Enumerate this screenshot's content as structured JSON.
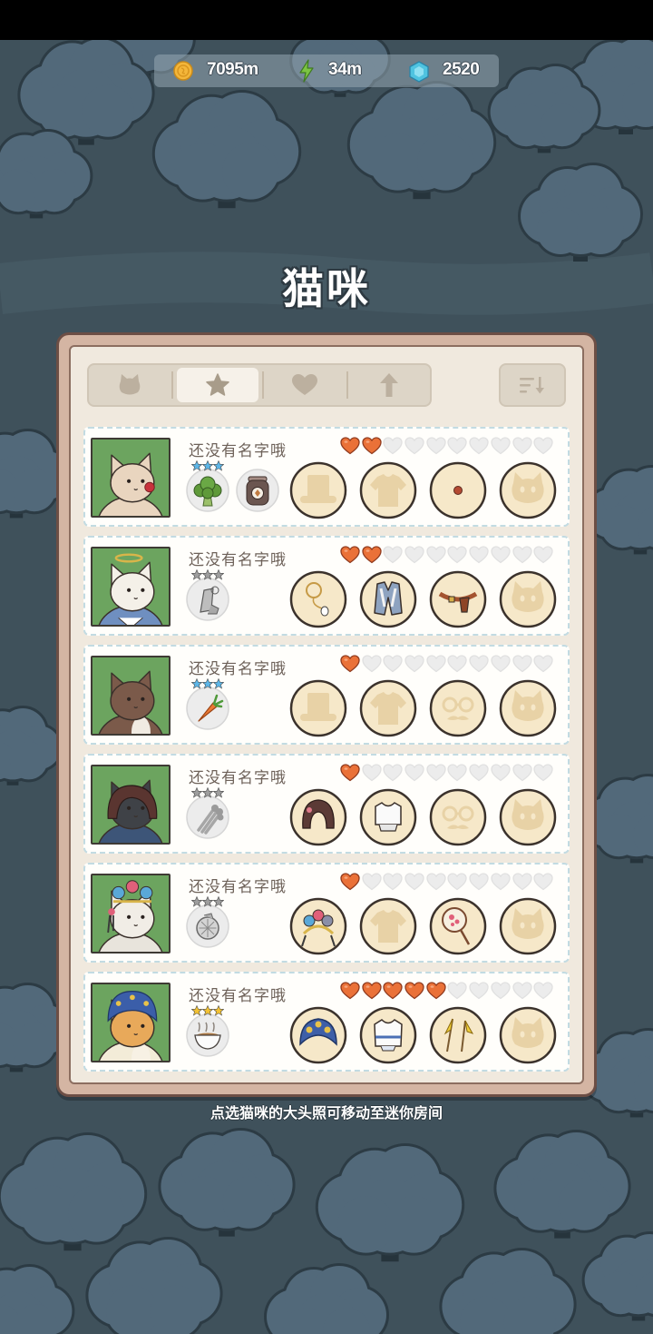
{
  "resources": {
    "coins": {
      "icon": "coin-icon",
      "value": "7095m"
    },
    "energy": {
      "icon": "lightning-icon",
      "value": "34m"
    },
    "gems": {
      "icon": "gem-icon",
      "value": "2520"
    }
  },
  "title": "猫咪",
  "tabs": [
    {
      "icon": "cat-icon",
      "selected": false
    },
    {
      "icon": "star-icon",
      "selected": true
    },
    {
      "icon": "heart-icon",
      "selected": false
    },
    {
      "icon": "arrow-up-icon",
      "selected": false
    }
  ],
  "sort_button": {
    "icon": "sort-descending-icon"
  },
  "hearts_max": 10,
  "colors": {
    "heart_filled": "#ea7138",
    "heart_empty": "#ececec",
    "avatar_bg": "#6ca45f",
    "slot_bg": "#f6e8c9"
  },
  "cats": [
    {
      "name": "还没有名字哦",
      "avatar": {
        "icon": "cream-cat-red-nose-portrait",
        "fur": "#e9d5bf"
      },
      "hearts": 2,
      "foods": [
        {
          "icon": "broccoli-icon",
          "stars": {
            "count": 3,
            "color": "#5cb6e8"
          }
        },
        {
          "icon": "treat-jar-icon",
          "stars": {
            "count": 0,
            "color": ""
          }
        }
      ],
      "slots": [
        {
          "icon": "hat-slot-empty-icon",
          "equipped": false
        },
        {
          "icon": "clothes-slot-empty-icon",
          "equipped": false
        },
        {
          "icon": "clown-nose-icon",
          "equipped": true
        },
        {
          "icon": "cat-slot-empty-icon",
          "equipped": false
        }
      ]
    },
    {
      "name": "还没有名字哦",
      "avatar": {
        "icon": "white-cat-halo-portrait",
        "fur": "#f4f0e8"
      },
      "hearts": 2,
      "foods": [
        {
          "icon": "stone-tool-icon",
          "stars": {
            "count": 3,
            "color": "#9e9e9e"
          }
        }
      ],
      "slots": [
        {
          "icon": "halo-icon",
          "equipped": true
        },
        {
          "icon": "vest-icon",
          "equipped": true
        },
        {
          "icon": "holster-belt-icon",
          "equipped": true
        },
        {
          "icon": "cat-slot-empty-icon",
          "equipped": false
        }
      ]
    },
    {
      "name": "还没有名字哦",
      "avatar": {
        "icon": "brown-cat-portrait",
        "fur": "#7b5a4a"
      },
      "hearts": 1,
      "foods": [
        {
          "icon": "carrot-icon",
          "stars": {
            "count": 3,
            "color": "#5cb6e8"
          }
        }
      ],
      "slots": [
        {
          "icon": "hat-slot-empty-icon",
          "equipped": false
        },
        {
          "icon": "clothes-slot-empty-icon",
          "equipped": false
        },
        {
          "icon": "glasses-slot-empty-icon",
          "equipped": false
        },
        {
          "icon": "cat-slot-empty-icon",
          "equipped": false
        }
      ]
    },
    {
      "name": "还没有名字哦",
      "avatar": {
        "icon": "black-cat-bob-hair-portrait",
        "fur": "#3f4247"
      },
      "hearts": 1,
      "foods": [
        {
          "icon": "celery-icon",
          "stars": {
            "count": 3,
            "color": "#9e9e9e"
          }
        }
      ],
      "slots": [
        {
          "icon": "bob-wig-icon",
          "equipped": true
        },
        {
          "icon": "crop-top-icon",
          "equipped": true
        },
        {
          "icon": "glasses-slot-empty-icon",
          "equipped": false
        },
        {
          "icon": "cat-slot-empty-icon",
          "equipped": false
        }
      ]
    },
    {
      "name": "还没有名字哦",
      "avatar": {
        "icon": "white-cat-headdress-portrait",
        "fur": "#f1ede6"
      },
      "hearts": 1,
      "foods": [
        {
          "icon": "lemon-slice-icon",
          "stars": {
            "count": 3,
            "color": "#9e9e9e"
          }
        }
      ],
      "slots": [
        {
          "icon": "ornate-headdress-icon",
          "equipped": true
        },
        {
          "icon": "clothes-slot-empty-icon",
          "equipped": false
        },
        {
          "icon": "round-fan-icon",
          "equipped": true
        },
        {
          "icon": "cat-slot-empty-icon",
          "equipped": false
        }
      ]
    },
    {
      "name": "还没有名字哦",
      "avatar": {
        "icon": "orange-cat-opera-headpiece-portrait",
        "fur": "#e8a95a"
      },
      "hearts": 5,
      "foods": [
        {
          "icon": "noodle-bowl-icon",
          "stars": {
            "count": 3,
            "color": "#f3c233"
          }
        }
      ],
      "slots": [
        {
          "icon": "opera-headpiece-icon",
          "equipped": true
        },
        {
          "icon": "white-armor-top-icon",
          "equipped": true
        },
        {
          "icon": "back-flags-icon",
          "equipped": true
        },
        {
          "icon": "cat-slot-empty-icon",
          "equipped": false
        }
      ]
    }
  ],
  "footer_hint": "点选猫咪的大头照可移动至迷你房间"
}
